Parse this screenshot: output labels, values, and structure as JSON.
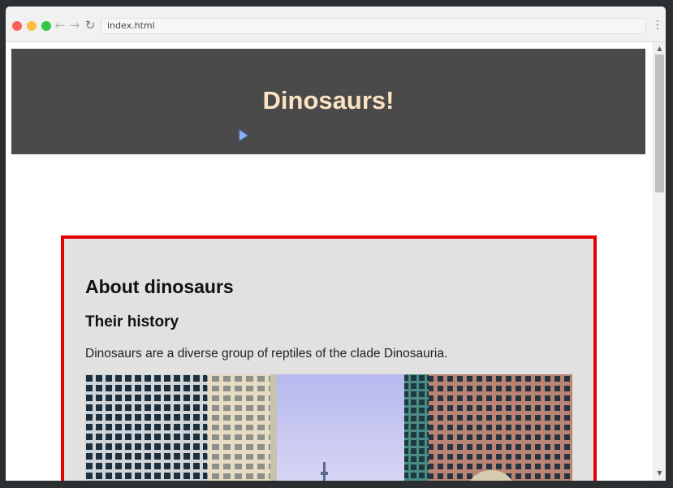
{
  "browser": {
    "address": "index.html",
    "back_icon": "←",
    "forward_icon": "→",
    "reload_icon": "↻",
    "menu_icon": "⋮"
  },
  "page": {
    "title": "Dinosaurs!",
    "section_heading": "About dinosaurs",
    "subheading": "Their history",
    "paragraph": "Dinosaurs are a diverse group of reptiles of the clade Dinosauria."
  },
  "colors": {
    "banner_bg": "#4a4a4a",
    "title_color": "#fbe3c4",
    "card_border": "#e40000",
    "card_bg": "#e1e1e1"
  },
  "scroll": {
    "position_fraction": 0.0
  }
}
